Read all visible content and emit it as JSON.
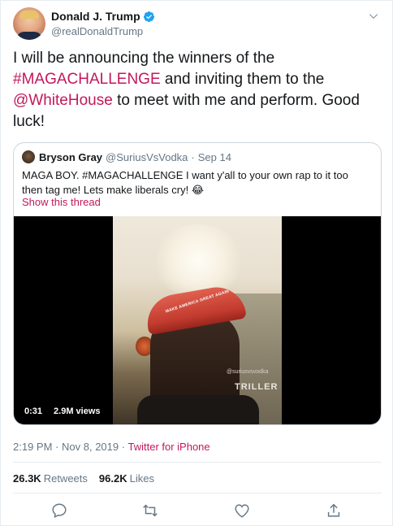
{
  "author": {
    "display_name": "Donald J. Trump",
    "handle": "@realDonaldTrump",
    "verified": true
  },
  "tweet": {
    "text_1": "I will be announcing the winners of the",
    "hashtag": "#MAGACHALLENGE",
    "text_2": "and inviting them to the",
    "mention": "@WhiteHouse",
    "text_3": "to meet with me and perform. Good luck!"
  },
  "quote": {
    "display_name": "Bryson Gray",
    "handle": "@SuriusVsVodka",
    "dot": "·",
    "date": "Sep 14",
    "text": "MAGA BOY. #MAGACHALLENGE I want y'all to your own rap to it too then tag me! Lets make liberals cry! 😂",
    "show_thread": "Show this thread",
    "video": {
      "duration": "0:31",
      "views": "2.9M views",
      "cap_text": "MAKE AMERICA GREAT AGAIN",
      "watermark_handle": "@suriusvsvodka",
      "watermark_logo": "TRILLER"
    }
  },
  "meta": {
    "time": "2:19 PM",
    "sep1": "·",
    "date": "Nov 8, 2019",
    "sep2": "·",
    "source": "Twitter for iPhone"
  },
  "stats": {
    "retweets_count": "26.3K",
    "retweets_label": "Retweets",
    "likes_count": "96.2K",
    "likes_label": "Likes"
  },
  "icons": {
    "caret": "chevron-down-icon",
    "reply": "reply-icon",
    "retweet": "retweet-icon",
    "like": "heart-icon",
    "share": "share-icon"
  },
  "colors": {
    "link": "#c2185b",
    "verified": "#1da1f2",
    "secondary_text": "#657786"
  }
}
